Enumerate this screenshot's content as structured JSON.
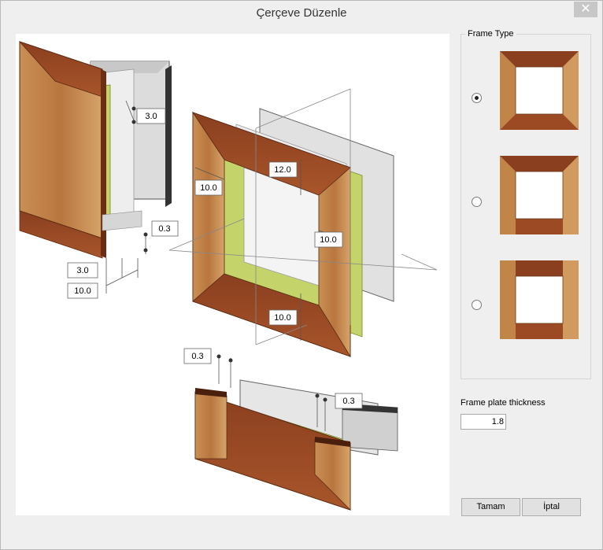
{
  "window": {
    "title": "Çerçeve Düzenle",
    "close_label": "✕"
  },
  "preview": {
    "dimensions": {
      "d1": "3.0",
      "d2": "0.3",
      "d3": "3.0",
      "d4": "10.0",
      "d5": "12.0",
      "d6": "10.0",
      "d7": "10.0",
      "d8": "10.0",
      "d9": "0.3",
      "d10": "0.3"
    }
  },
  "frame_type": {
    "title": "Frame Type",
    "options": [
      {
        "icon": "full-mitered-frame-icon",
        "selected": true
      },
      {
        "icon": "top-bottom-frame-icon",
        "selected": false
      },
      {
        "icon": "side-frame-icon",
        "selected": false
      }
    ]
  },
  "thickness": {
    "label": "Frame plate thickness",
    "value": "1.8"
  },
  "buttons": {
    "ok": "Tamam",
    "cancel": "İptal"
  },
  "colors": {
    "wood": "#a0522d",
    "wood_dark": "#7a3a1e",
    "wood_light": "#c9945a",
    "insulation": "#c5d36b",
    "metal": "#d9d9d9"
  }
}
